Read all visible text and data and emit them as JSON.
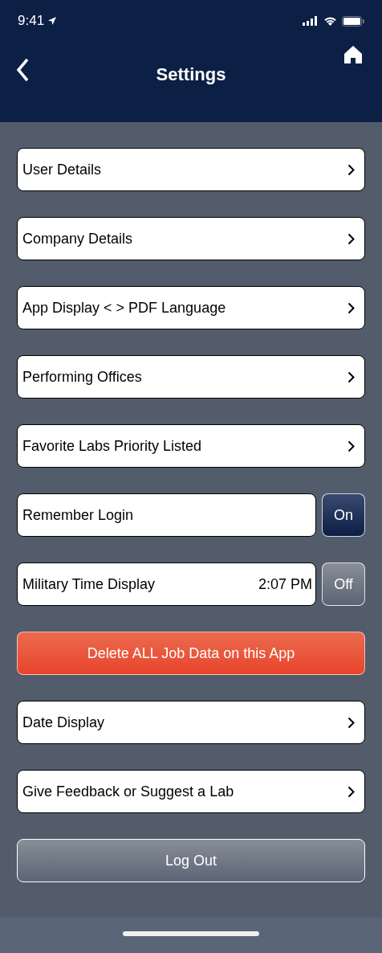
{
  "status_bar": {
    "time": "9:41"
  },
  "header": {
    "title": "Settings"
  },
  "items": [
    {
      "kind": "link",
      "label": "User Details"
    },
    {
      "kind": "link",
      "label": "Company Details"
    },
    {
      "kind": "link",
      "label": "App Display < > PDF Language"
    },
    {
      "kind": "link",
      "label": "Performing Offices"
    },
    {
      "kind": "link",
      "label": "Favorite Labs Priority Listed"
    },
    {
      "kind": "toggle",
      "label": "Remember Login",
      "on": true,
      "toggle_label": "On"
    },
    {
      "kind": "toggle",
      "label": "Military Time Display",
      "value": "2:07 PM",
      "on": false,
      "toggle_label": "Off"
    },
    {
      "kind": "danger",
      "label": "Delete ALL Job Data on this App"
    },
    {
      "kind": "link",
      "label": "Date Display"
    },
    {
      "kind": "link",
      "label": "Give Feedback or Suggest a Lab"
    },
    {
      "kind": "button",
      "label": "Log Out"
    }
  ]
}
